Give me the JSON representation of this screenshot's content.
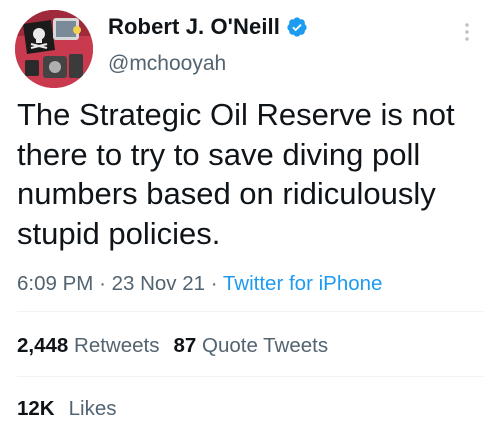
{
  "author": {
    "name": "Robert J. O'Neill",
    "handle": "@mchooyah",
    "avatar_icon": "avatar-skull-flag",
    "verified_icon": "verified-badge-icon",
    "verified_color": "#1d9bf0"
  },
  "menu_icon": "more-vertical-icon",
  "tweet": {
    "text": "The Strategic Oil Reserve is not there to try to save diving poll numbers based on ridiculously stupid policies.",
    "time": "6:09 PM",
    "date": "23 Nov 21",
    "separator": "·",
    "source": "Twitter for iPhone",
    "source_color": "#1d9bf0"
  },
  "stats": {
    "retweets_count": "2,448",
    "retweets_label": "Retweets",
    "quote_count": "87",
    "quote_label": "Quote Tweets",
    "likes_count": "12K",
    "likes_label": "Likes"
  },
  "colors": {
    "text_primary": "#0f1419",
    "text_secondary": "#536471",
    "divider": "#eff3f4"
  }
}
